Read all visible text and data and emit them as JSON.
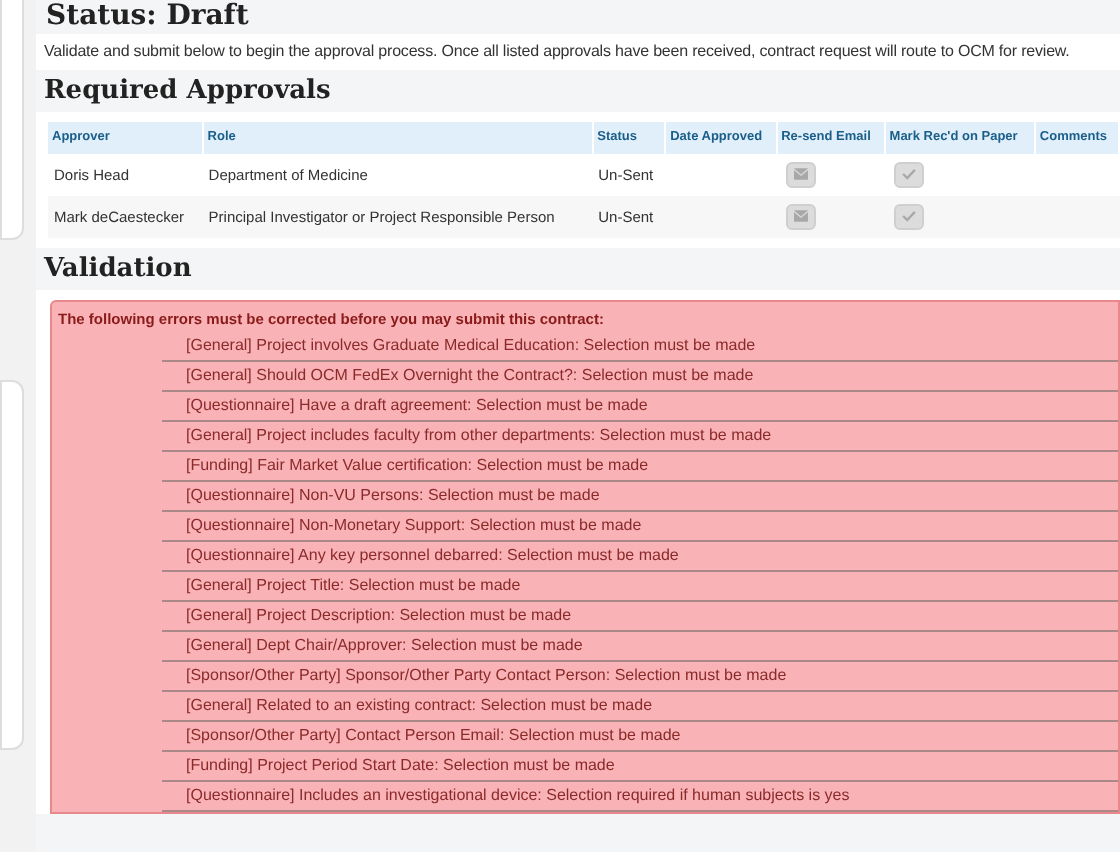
{
  "status_heading": "Status: Draft",
  "intro": "Validate and submit below to begin the approval process. Once all listed approvals have been received, contract request will route to OCM for review.",
  "approvals": {
    "heading": "Required Approvals",
    "columns": [
      "Approver",
      "Role",
      "Status",
      "Date Approved",
      "Re-send Email",
      "Mark Rec'd on Paper",
      "Comments"
    ],
    "rows": [
      {
        "approver": "Doris Head",
        "role": "Department of Medicine",
        "status": "Un-Sent"
      },
      {
        "approver": "Mark deCaestecker",
        "role": "Principal Investigator or Project Responsible Person",
        "status": "Un-Sent"
      }
    ]
  },
  "validation": {
    "heading": "Validation",
    "title": "The following errors must be corrected before you may submit this contract:",
    "errors": [
      "[General] Project involves Graduate Medical Education: Selection must be made",
      "[General] Should OCM FedEx Overnight the Contract?: Selection must be made",
      "[Questionnaire] Have a draft agreement: Selection must be made",
      "[General] Project includes faculty from other departments: Selection must be made",
      "[Funding] Fair Market Value certification: Selection must be made",
      "[Questionnaire] Non-VU Persons: Selection must be made",
      "[Questionnaire] Non-Monetary Support: Selection must be made",
      "[Questionnaire] Any key personnel debarred: Selection must be made",
      "[General] Project Title: Selection must be made",
      "[General] Project Description: Selection must be made",
      "[General] Dept Chair/Approver: Selection must be made",
      "[Sponsor/Other Party] Sponsor/Other Party Contact Person: Selection must be made",
      "[General] Related to an existing contract: Selection must be made",
      "[Sponsor/Other Party] Contact Person Email: Selection must be made",
      "[Funding] Project Period Start Date: Selection must be made",
      "[Questionnaire] Includes an investigational device: Selection required if human subjects is yes"
    ]
  }
}
